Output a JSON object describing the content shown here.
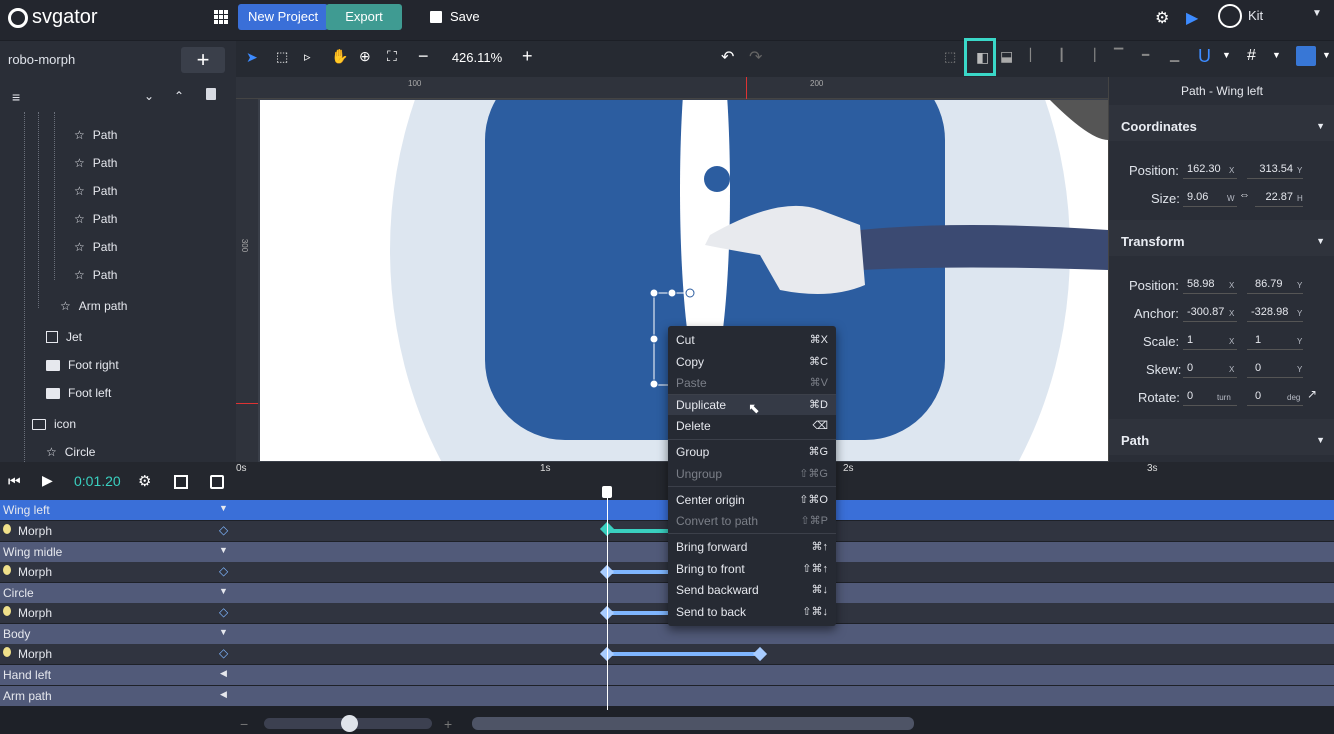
{
  "app": {
    "logo_text": "svgator",
    "new_project_label": "New Project",
    "export_label": "Export",
    "save_label": "Save",
    "user_name": "Kit"
  },
  "sidebar": {
    "project_name": "robo-morph",
    "layers": [
      {
        "label": "Path"
      },
      {
        "label": "Path"
      },
      {
        "label": "Path"
      },
      {
        "label": "Path"
      },
      {
        "label": "Path"
      },
      {
        "label": "Path"
      },
      {
        "label": "Arm path"
      },
      {
        "label": "Jet"
      },
      {
        "label": "Foot right"
      },
      {
        "label": "Foot left"
      },
      {
        "label": "icon"
      },
      {
        "label": "Circle"
      }
    ]
  },
  "toolbar": {
    "zoom_value": "426.11%"
  },
  "ruler": {
    "top_labels": [
      "100",
      "200"
    ],
    "left_label": "300"
  },
  "right_panel": {
    "title": "Path - Wing left",
    "coordinates_title": "Coordinates",
    "position_label": "Position:",
    "position_x": "162.30",
    "position_y": "313.54",
    "size_label": "Size:",
    "size_w": "9.06",
    "size_h": "22.87",
    "transform_title": "Transform",
    "t_position_label": "Position:",
    "t_position_x": "58.98",
    "t_position_y": "86.79",
    "anchor_label": "Anchor:",
    "anchor_x": "-300.87",
    "anchor_y": "-328.98",
    "scale_label": "Scale:",
    "scale_x": "1",
    "scale_y": "1",
    "skew_label": "Skew:",
    "skew_x": "0",
    "skew_y": "0",
    "rotate_label": "Rotate:",
    "rotate_turn": "0",
    "rotate_deg": "0",
    "unit_x": "X",
    "unit_y": "Y",
    "unit_w": "W",
    "unit_h": "H",
    "unit_turn": "turn",
    "unit_deg": "deg",
    "path_title": "Path"
  },
  "timeline": {
    "time": "0:01.20",
    "ticks": [
      "0s",
      "1s",
      "2s",
      "3s"
    ],
    "tracks": [
      {
        "label": "Wing left"
      },
      {
        "label": "Morph"
      },
      {
        "label": "Wing midle"
      },
      {
        "label": "Morph"
      },
      {
        "label": "Circle"
      },
      {
        "label": "Morph"
      },
      {
        "label": "Body"
      },
      {
        "label": "Morph"
      },
      {
        "label": "Hand left"
      },
      {
        "label": "Arm path"
      }
    ]
  },
  "context_menu": {
    "items": [
      {
        "label": "Cut",
        "shortcut": "⌘X"
      },
      {
        "label": "Copy",
        "shortcut": "⌘C"
      },
      {
        "label": "Paste",
        "shortcut": "⌘V"
      },
      {
        "label": "Duplicate",
        "shortcut": "⌘D"
      },
      {
        "label": "Delete",
        "shortcut": "⌫"
      },
      {
        "label": "Group",
        "shortcut": "⌘G"
      },
      {
        "label": "Ungroup",
        "shortcut": "⇧⌘G"
      },
      {
        "label": "Center origin",
        "shortcut": "⇧⌘O"
      },
      {
        "label": "Convert to path",
        "shortcut": "⇧⌘P"
      },
      {
        "label": "Bring forward",
        "shortcut": "⌘↑"
      },
      {
        "label": "Bring to front",
        "shortcut": "⇧⌘↑"
      },
      {
        "label": "Send backward",
        "shortcut": "⌘↓"
      },
      {
        "label": "Send to back",
        "shortcut": "⇧⌘↓"
      }
    ]
  }
}
